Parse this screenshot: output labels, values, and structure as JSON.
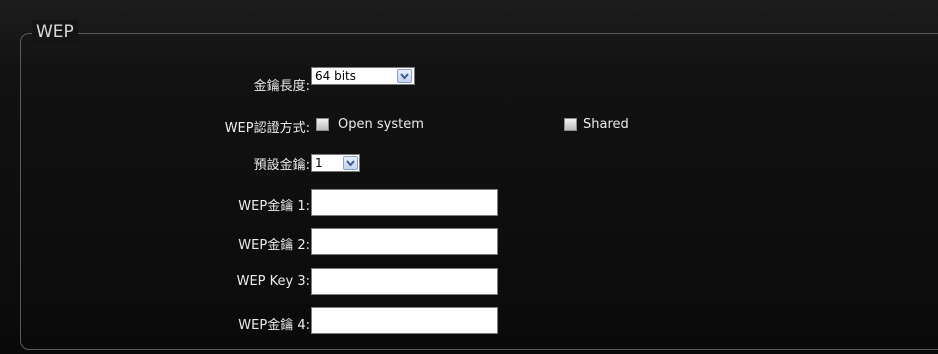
{
  "section": {
    "legend": "WEP"
  },
  "form": {
    "key_length": {
      "label": "金鑰長度:",
      "selected": "64 bits"
    },
    "auth_mode": {
      "label": "WEP認證方式:",
      "options": [
        "Open system",
        "Shared"
      ]
    },
    "default_key": {
      "label": "預設金鑰:",
      "selected": "1"
    },
    "keys": [
      {
        "label": "WEP金鑰 1:",
        "value": ""
      },
      {
        "label": "WEP金鑰 2:",
        "value": ""
      },
      {
        "label": "WEP Key 3:",
        "value": ""
      },
      {
        "label": "WEP金鑰 4:",
        "value": ""
      }
    ]
  },
  "icons": {
    "dropdown": "chevron-down-icon"
  },
  "colors": {
    "background": "#0f0f0f",
    "border": "#5a5a5a",
    "text": "#ececec",
    "dropdown_button": "#c5d3ee"
  }
}
